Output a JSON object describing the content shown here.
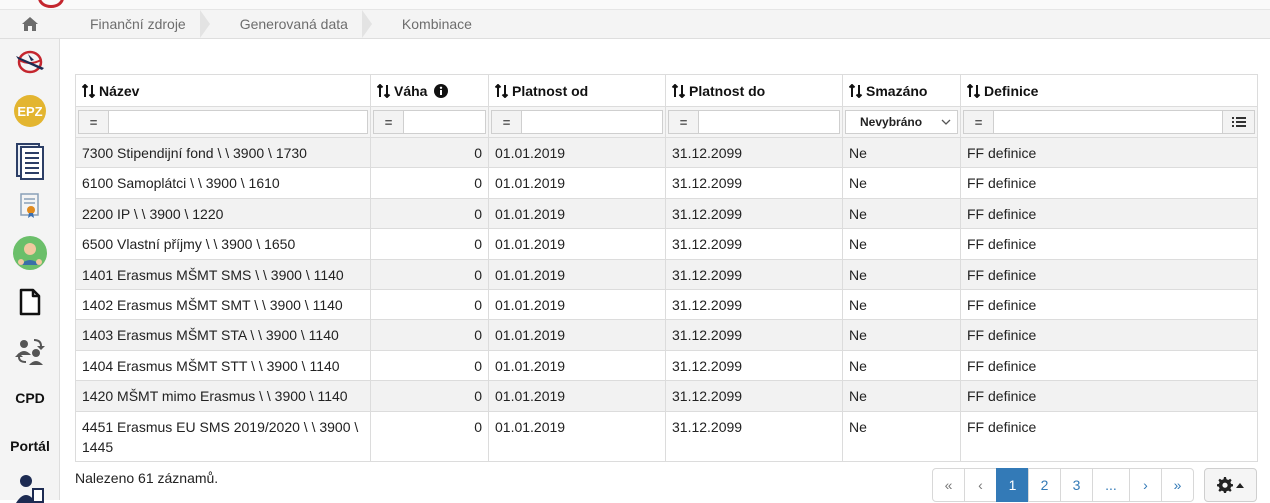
{
  "breadcrumb": {
    "home_icon": "home-icon",
    "items": [
      "Finanční zdroje",
      "Generovaná data",
      "Kombinace"
    ]
  },
  "sidebar": {
    "items": [
      {
        "icon": "plane-globe-icon"
      },
      {
        "icon": "epz-badge-icon",
        "label": "EPZ"
      },
      {
        "icon": "document-list-icon"
      },
      {
        "icon": "certificate-icon"
      },
      {
        "icon": "person-avatar-icon"
      },
      {
        "icon": "file-icon"
      },
      {
        "icon": "people-exchange-icon"
      },
      {
        "icon": "cpd-icon",
        "label": "CPD"
      },
      {
        "icon": "portal-icon",
        "label": "Portál"
      },
      {
        "icon": "person-document-icon"
      }
    ]
  },
  "table": {
    "columns": [
      {
        "label": "Název"
      },
      {
        "label": "Váha",
        "info_icon": "info-icon"
      },
      {
        "label": "Platnost od"
      },
      {
        "label": "Platnost do"
      },
      {
        "label": "Smazáno"
      },
      {
        "label": "Definice"
      }
    ],
    "filters": {
      "operator": "=",
      "smazano_value": "Nevybráno"
    },
    "rows": [
      {
        "nazev": "7300 Stipendijní fond \\ \\ 3900 \\ 1730",
        "vaha": "0",
        "od": "01.01.2019",
        "do": "31.12.2099",
        "smazano": "Ne",
        "definice": "FF definice"
      },
      {
        "nazev": "6100 Samoplátci \\ \\ 3900 \\ 1610",
        "vaha": "0",
        "od": "01.01.2019",
        "do": "31.12.2099",
        "smazano": "Ne",
        "definice": "FF definice"
      },
      {
        "nazev": "2200 IP \\ \\ 3900 \\ 1220",
        "vaha": "0",
        "od": "01.01.2019",
        "do": "31.12.2099",
        "smazano": "Ne",
        "definice": "FF definice"
      },
      {
        "nazev": "6500 Vlastní příjmy \\ \\ 3900 \\ 1650",
        "vaha": "0",
        "od": "01.01.2019",
        "do": "31.12.2099",
        "smazano": "Ne",
        "definice": "FF definice"
      },
      {
        "nazev": "1401 Erasmus MŠMT SMS \\ \\ 3900 \\ 1140",
        "vaha": "0",
        "od": "01.01.2019",
        "do": "31.12.2099",
        "smazano": "Ne",
        "definice": "FF definice"
      },
      {
        "nazev": "1402 Erasmus MŠMT SMT \\ \\ 3900 \\ 1140",
        "vaha": "0",
        "od": "01.01.2019",
        "do": "31.12.2099",
        "smazano": "Ne",
        "definice": "FF definice"
      },
      {
        "nazev": "1403 Erasmus MŠMT STA \\ \\ 3900 \\ 1140",
        "vaha": "0",
        "od": "01.01.2019",
        "do": "31.12.2099",
        "smazano": "Ne",
        "definice": "FF definice"
      },
      {
        "nazev": "1404 Erasmus MŠMT STT \\ \\ 3900 \\ 1140",
        "vaha": "0",
        "od": "01.01.2019",
        "do": "31.12.2099",
        "smazano": "Ne",
        "definice": "FF definice"
      },
      {
        "nazev": "1420 MŠMT mimo Erasmus \\ \\ 3900 \\ 1140",
        "vaha": "0",
        "od": "01.01.2019",
        "do": "31.12.2099",
        "smazano": "Ne",
        "definice": "FF definice"
      },
      {
        "nazev": "4451 Erasmus EU SMS 2019/2020 \\ \\ 3900 \\ 1445",
        "vaha": "0",
        "od": "01.01.2019",
        "do": "31.12.2099",
        "smazano": "Ne",
        "definice": "FF definice"
      }
    ]
  },
  "footer": {
    "found_text": "Nalezeno 61 záznamů.",
    "pager": [
      "«",
      "‹",
      "1",
      "2",
      "3",
      "...",
      "›",
      "»"
    ],
    "active_page": "1",
    "settings_icon": "gear-icon"
  },
  "colors": {
    "accent": "#337ab7",
    "epz": "#e3b530",
    "row_alt": "#f2f2f2"
  }
}
